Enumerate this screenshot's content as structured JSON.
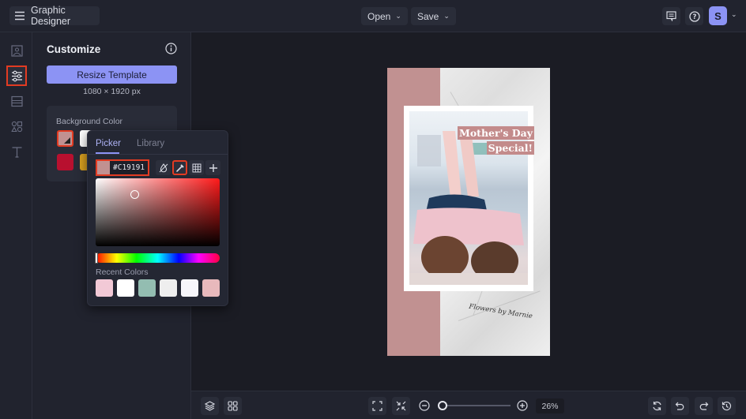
{
  "app": {
    "title": "Graphic Designer",
    "menu_icon": "hamburger-icon"
  },
  "topbar": {
    "open_label": "Open",
    "save_label": "Save",
    "comments_icon": "comment-icon",
    "help_icon": "help-icon",
    "avatar_initial": "S",
    "colors": {
      "accent": "#8C93F4"
    }
  },
  "rail": {
    "items": [
      {
        "name": "photos",
        "icon": "image-icon",
        "active": false
      },
      {
        "name": "customize",
        "icon": "sliders-icon",
        "active": true
      },
      {
        "name": "layout",
        "icon": "layout-icon",
        "active": false
      },
      {
        "name": "graphics",
        "icon": "shapes-icon",
        "active": false
      },
      {
        "name": "text",
        "icon": "text-icon",
        "active": false
      }
    ]
  },
  "panel": {
    "title": "Customize",
    "resize_label": "Resize Template",
    "dimensions": "1080 × 1920 px",
    "background_color_label": "Background Color",
    "swatches": [
      "#C19191",
      "#FFFFFF",
      "#B8102F",
      "#D9A020"
    ]
  },
  "color_picker": {
    "tabs": [
      "Picker",
      "Library"
    ],
    "active_tab": "Picker",
    "hex_value": "#C19191",
    "tools": [
      "no-color-icon",
      "eyedropper-icon",
      "grid-icon",
      "plus-icon"
    ],
    "recent_label": "Recent Colors",
    "recent_colors": [
      "#F2C9D6",
      "#FFFFFF",
      "#93BDB1",
      "#EEEEEE",
      "#F6F6FA",
      "#E8B9BC"
    ]
  },
  "poster": {
    "title_line1": "Mother's Day",
    "title_line2": "Special!",
    "signature": "Flowers by Marnie",
    "band_color": "#C19191"
  },
  "bottombar": {
    "zoom_percent": "26%",
    "zoom_value": 0.26
  }
}
